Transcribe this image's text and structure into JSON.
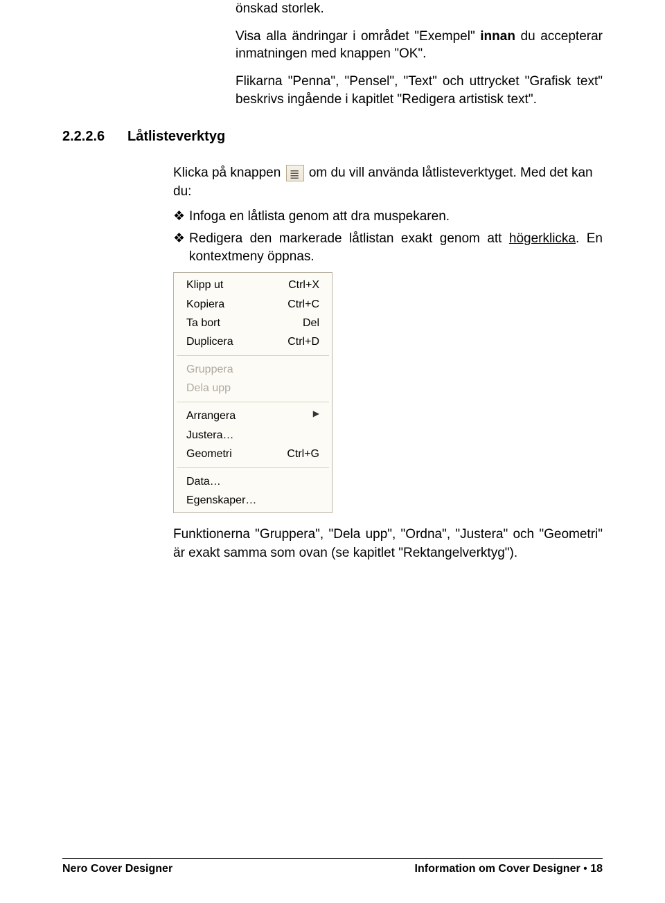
{
  "intro": {
    "p1": "önskad storlek.",
    "p2_a": "Visa alla ändringar i området \"Exempel\" ",
    "p2_b": "innan",
    "p2_c": " du accepterar inmatningen med knappen \"OK\".",
    "p3": "Flikarna \"Penna\", \"Pensel\", \"Text\" och uttrycket \"Grafisk text\" beskrivs ingående i kapitlet \"Redigera artistisk text\"."
  },
  "section": {
    "number": "2.2.2.6",
    "title": "Låtlisteverktyg"
  },
  "body": {
    "line1_a": "Klicka på knappen ",
    "line1_b": " om du vill använda låtlisteverktyget. Med det kan du:",
    "b1": "Infoga en låtlista genom att dra muspekaren.",
    "b2_a": "Redigera den markerade låtlistan exakt genom att ",
    "b2_u": "högerklicka",
    "b2_b": ". En kontextmeny öppnas.",
    "after_menu": "Funktionerna \"Gruppera\", \"Dela upp\", \"Ordna\", \"Justera\" och \"Geometri\" är exakt samma som ovan (se kapitlet \"Rektangelverktyg\")."
  },
  "menu": {
    "g1": [
      {
        "label": "Klipp ut",
        "shortcut": "Ctrl+X"
      },
      {
        "label": "Kopiera",
        "shortcut": "Ctrl+C"
      },
      {
        "label": "Ta bort",
        "shortcut": "Del"
      },
      {
        "label": "Duplicera",
        "shortcut": "Ctrl+D"
      }
    ],
    "g2": [
      {
        "label": "Gruppera"
      },
      {
        "label": "Dela upp"
      }
    ],
    "g3": [
      {
        "label": "Arrangera",
        "submenu": true
      },
      {
        "label": "Justera…"
      },
      {
        "label": "Geometri",
        "shortcut": "Ctrl+G"
      }
    ],
    "g4": [
      {
        "label": "Data…"
      },
      {
        "label": "Egenskaper…"
      }
    ]
  },
  "footer": {
    "left": "Nero Cover Designer",
    "right_a": "Information om Cover Designer",
    "dot": "  •  ",
    "right_page": "18"
  },
  "glyphs": {
    "bullet": "❖",
    "arrow": "▶"
  }
}
